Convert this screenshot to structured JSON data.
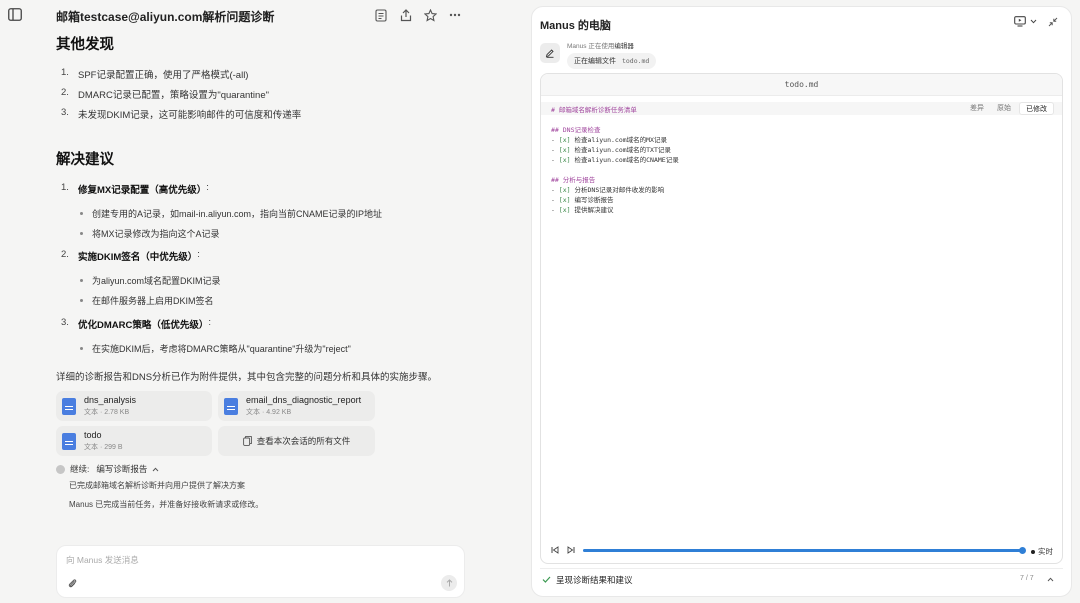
{
  "chat": {
    "title": "邮箱testcase@aliyun.com解析问题诊断",
    "other_findings_heading": "其他发现",
    "other_findings": [
      {
        "num": "1.",
        "text": "SPF记录配置正确，使用了严格模式(-all)"
      },
      {
        "num": "2.",
        "text": "DMARC记录已配置，策略设置为\"quarantine\""
      },
      {
        "num": "3.",
        "text": "未发现DKIM记录，这可能影响邮件的可信度和传递率"
      }
    ],
    "solutions_heading": "解决建议",
    "solutions": [
      {
        "num": "1.",
        "title": "修复MX记录配置（高优先级）",
        "colon": ":",
        "items": [
          "创建专用的A记录，如mail-in.aliyun.com，指向当前CNAME记录的IP地址",
          "将MX记录修改为指向这个A记录"
        ]
      },
      {
        "num": "2.",
        "title": "实施DKIM签名（中优先级）",
        "colon": ":",
        "items": [
          "为aliyun.com域名配置DKIM记录",
          "在邮件服务器上启用DKIM签名"
        ]
      },
      {
        "num": "3.",
        "title": "优化DMARC策略（低优先级）",
        "colon": ":",
        "items": [
          "在实施DKIM后，考虑将DMARC策略从\"quarantine\"升级为\"reject\""
        ]
      }
    ],
    "summary": "详细的诊断报告和DNS分析已作为附件提供，其中包含完整的问题分析和具体的实施步骤。",
    "files": [
      {
        "name": "dns_analysis",
        "meta": "文本 · 2.78 KB"
      },
      {
        "name": "email_dns_diagnostic_report",
        "meta": "文本 · 4.92 KB"
      },
      {
        "name": "todo",
        "meta": "文本 · 299 B"
      }
    ],
    "view_all_files": "查看本次会话的所有文件",
    "status_prefix": "继续:",
    "status_task": "编写诊断报告",
    "status_line": "已完成邮箱域名解析诊断并向用户提供了解决方案",
    "final_message": "Manus 已完成当前任务，并准备好接收新请求或修改。",
    "input_placeholder": "向 Manus 发送消息"
  },
  "computer": {
    "title": "Manus 的电脑",
    "activity_prefix": "Manus 正在使用",
    "activity_tool": "编辑器",
    "editing_label": "正在编辑文件",
    "editing_file": "todo.md",
    "editor_tab": "todo.md",
    "view_tabs": [
      "差异",
      "原始",
      "已修改"
    ],
    "active_view": "已修改",
    "code_lines": [
      {
        "kind": "head",
        "text": "# 邮箱域名解析诊断任务清单"
      },
      {
        "kind": "blank",
        "text": ""
      },
      {
        "kind": "head",
        "text": "## DNS记录检查"
      },
      {
        "kind": "task",
        "dash": "-",
        "check": "[x]",
        "text": "检查aliyun.com域名的MX记录"
      },
      {
        "kind": "task",
        "dash": "-",
        "check": "[x]",
        "text": "检查aliyun.com域名的TXT记录"
      },
      {
        "kind": "task",
        "dash": "-",
        "check": "[x]",
        "text": "检查aliyun.com域名的CNAME记录"
      },
      {
        "kind": "blank",
        "text": ""
      },
      {
        "kind": "head",
        "text": "## 分析与报告"
      },
      {
        "kind": "task",
        "dash": "-",
        "check": "[x]",
        "text": "分析DNS记录对邮件收发的影响"
      },
      {
        "kind": "task",
        "dash": "-",
        "check": "[x]",
        "text": "编写诊断报告"
      },
      {
        "kind": "task",
        "dash": "-",
        "check": "[x]",
        "text": "提供解决建议"
      }
    ],
    "live_label": "实时",
    "playback_progress": 1.0,
    "step_text": "呈现诊断结果和建议",
    "step_counter": "7 / 7",
    "colors": {
      "accent": "#2f7fd6",
      "check_green": "#3c9a52",
      "file_blue": "#4a7ee0"
    }
  }
}
